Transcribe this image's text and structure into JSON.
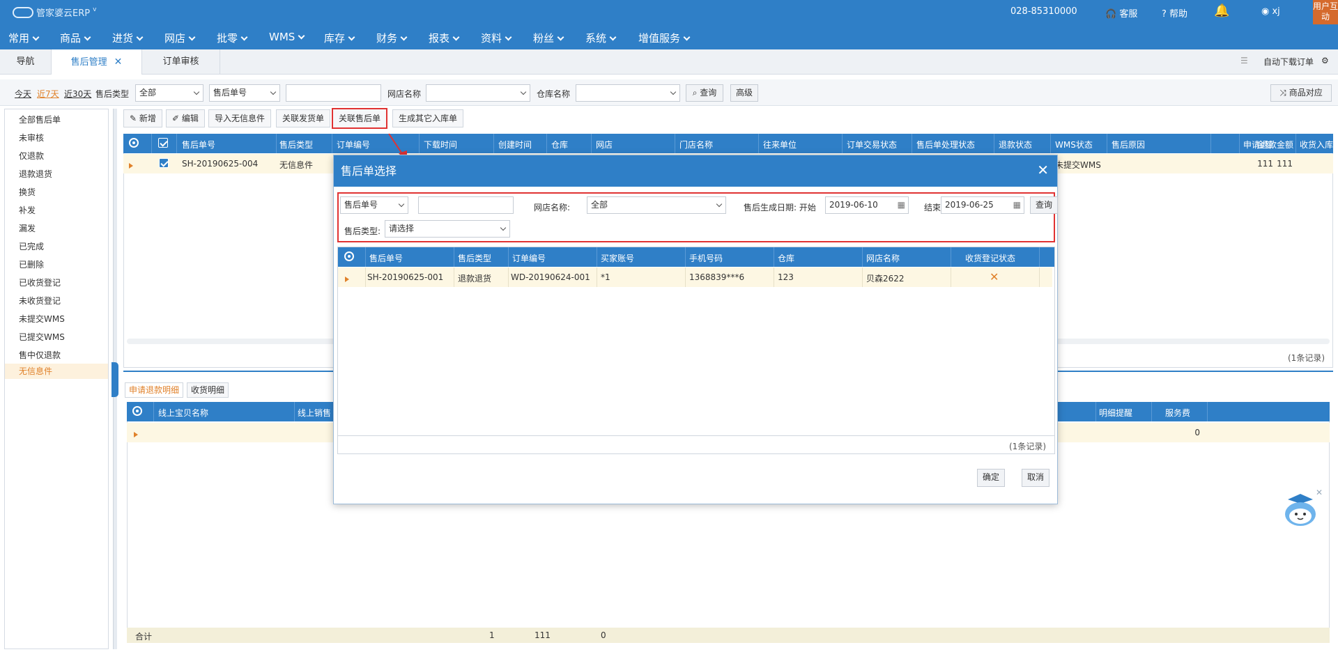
{
  "header": {
    "logo_text": "管家婆云ERP",
    "phone": "028-85310000",
    "service_label": "客服",
    "help_label": "帮助",
    "user_name": "xj",
    "user_badge": "用户互动"
  },
  "menu": [
    "常用",
    "商品",
    "进货",
    "网店",
    "批零",
    "WMS",
    "库存",
    "财务",
    "报表",
    "资料",
    "粉丝",
    "系统",
    "增值服务"
  ],
  "tabs": {
    "nav": "导航",
    "after_sale": "售后管理",
    "order_review": "订单审核",
    "auto_download": "自动下载订单"
  },
  "filter": {
    "today": "今天",
    "last7": "近7天",
    "last30": "近30天",
    "type_label": "售后类型",
    "type_value": "全部",
    "field_value": "售后单号",
    "shop_label": "网店名称",
    "warehouse_label": "仓库名称",
    "query_btn": "查询",
    "advanced_btn": "高级",
    "product_match_btn": "商品对应"
  },
  "left_menu": [
    "全部售后单",
    "未审核",
    "仅退款",
    "退款退货",
    "换货",
    "补发",
    "漏发",
    "已完成",
    "已删除",
    "已收货登记",
    "未收货登记",
    "未提交WMS",
    "已提交WMS",
    "售中仅退款",
    "无信息件"
  ],
  "toolbar": {
    "add": "新增",
    "edit": "编辑",
    "import": "导入无信息件",
    "link_ship": "关联发货单",
    "link_after": "关联售后单",
    "gen_other": "生成其它入库单"
  },
  "main_grid": {
    "headers": [
      "售后单号",
      "售后类型",
      "订单编号",
      "下载时间",
      "创建时间",
      "仓库",
      "网店",
      "门店名称",
      "往来单位",
      "订单交易状态",
      "售后单处理状态",
      "退款状态",
      "WMS状态",
      "售后原因",
      "金额",
      "申请退款金额",
      "收货入库"
    ],
    "row": {
      "order_no": "SH-20190625-004",
      "type": "无信息件",
      "wms": "未提交WMS",
      "amount": "111",
      "refund": "111"
    },
    "records": "(1条记录)"
  },
  "bottom": {
    "tab_refund": "申请退款明细",
    "tab_receive": "收货明细",
    "headers_left": [
      "线上宝贝名称",
      "线上销售"
    ],
    "headers_right": [
      "明细提醒",
      "服务费"
    ],
    "row_service_fee": "0",
    "total_label": "合计",
    "total_qty": "1",
    "total_amount": "111",
    "total_zero": "0"
  },
  "modal": {
    "title": "售后单选择",
    "field_select": "售后单号",
    "field_input": "",
    "shop_label": "网店名称:",
    "shop_value": "全部",
    "date_label": "售后生成日期: 开始",
    "date_start": "2019-06-10",
    "end_label": "结束",
    "date_end": "2019-06-25",
    "query_btn": "查询",
    "type_label": "售后类型:",
    "type_value": "请选择",
    "headers": [
      "售后单号",
      "售后类型",
      "订单编号",
      "买家账号",
      "手机号码",
      "仓库",
      "网店名称",
      "收货登记状态"
    ],
    "rows": [
      {
        "no": "SH-20190625-001",
        "type": "退款退货",
        "order": "WD-20190624-001",
        "buyer": "*1",
        "phone": "1368839***6",
        "warehouse": "123",
        "shop": "贝森2622"
      }
    ],
    "records": "(1条记录)",
    "ok_btn": "确定",
    "cancel_btn": "取消"
  },
  "colors": {
    "primary": "#2f7fc7",
    "highlight": "#e03232",
    "accent": "#e0812a"
  }
}
